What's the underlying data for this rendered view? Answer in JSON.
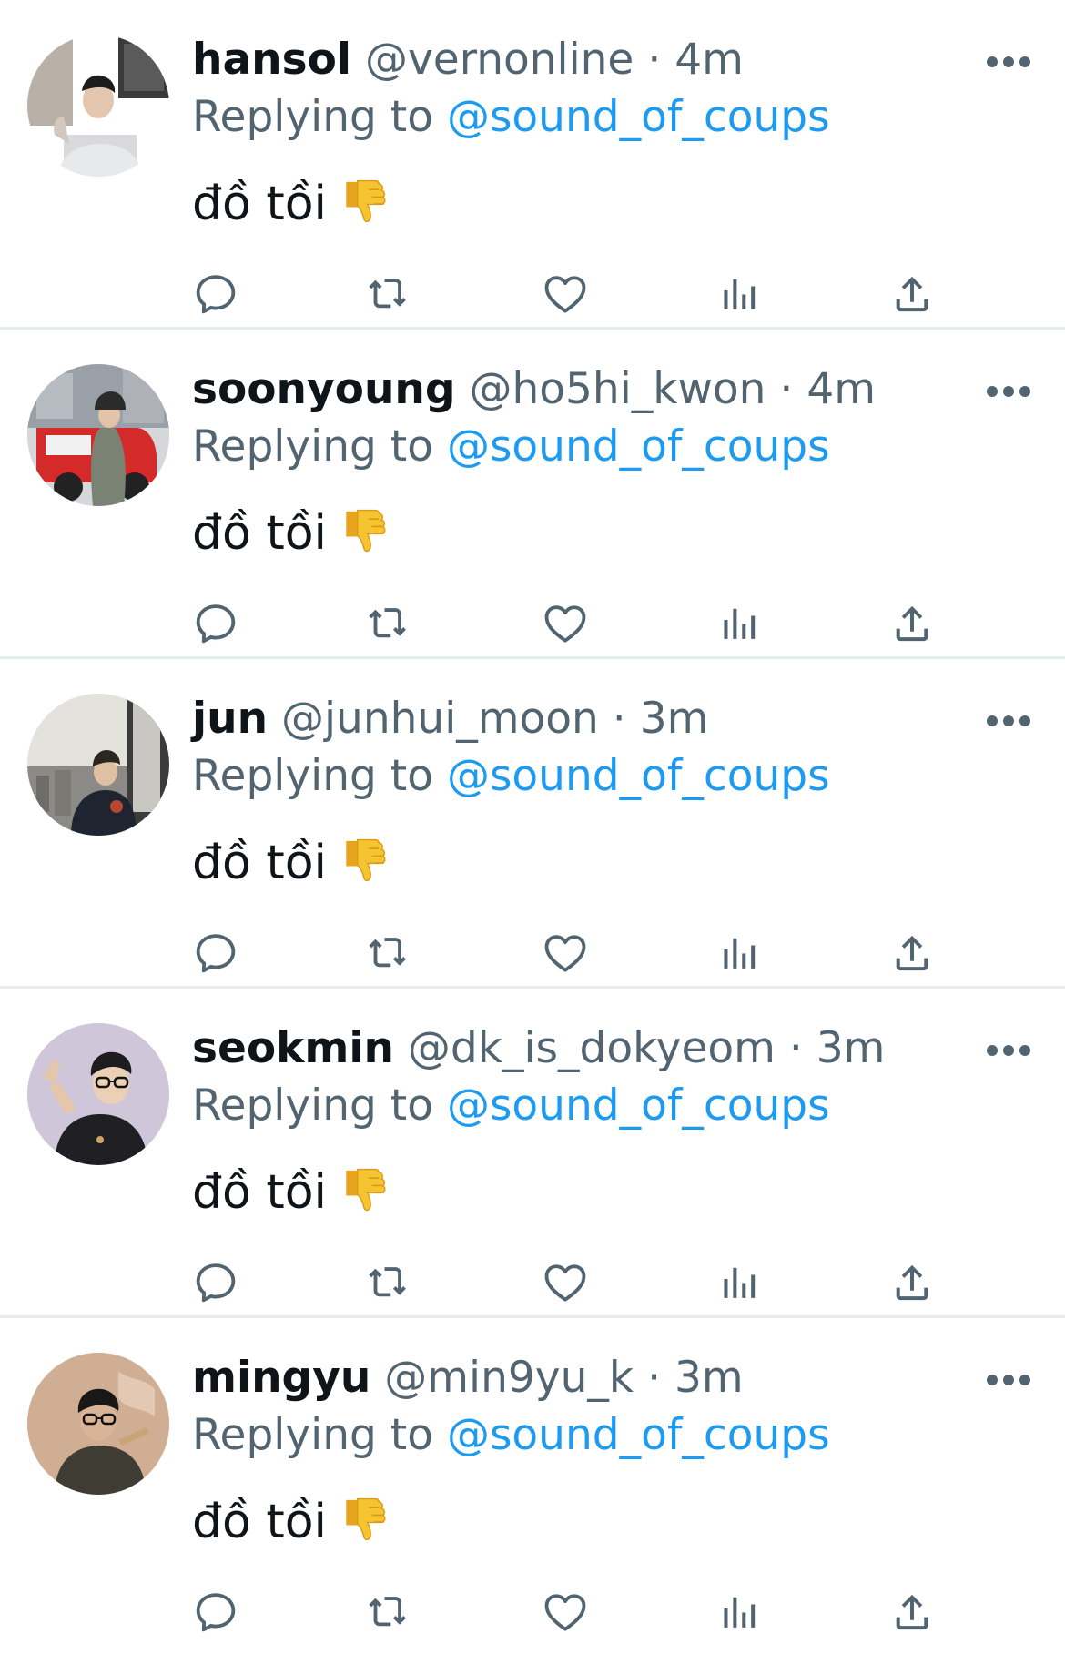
{
  "tweets": [
    {
      "display_name": "hansol",
      "handle": "@vernonline",
      "separator": "·",
      "time": "4m",
      "replying_prefix": "Replying to",
      "replying_to": "@sound_of_coups",
      "text": "đồ tồi",
      "emoji": "thumbs-down"
    },
    {
      "display_name": "soonyoung",
      "handle": "@ho5hi_kwon",
      "separator": "·",
      "time": "4m",
      "replying_prefix": "Replying to",
      "replying_to": "@sound_of_coups",
      "text": "đồ tồi",
      "emoji": "thumbs-down"
    },
    {
      "display_name": "jun",
      "handle": "@junhui_moon",
      "separator": "·",
      "time": "3m",
      "replying_prefix": "Replying to",
      "replying_to": "@sound_of_coups",
      "text": "đồ tồi",
      "emoji": "thumbs-down"
    },
    {
      "display_name": "seokmin",
      "handle": "@dk_is_dokyeom",
      "separator": "·",
      "time": "3m",
      "replying_prefix": "Replying to",
      "replying_to": "@sound_of_coups",
      "text": "đồ tồi",
      "emoji": "thumbs-down"
    },
    {
      "display_name": "mingyu",
      "handle": "@min9yu_k",
      "separator": "·",
      "time": "3m",
      "replying_prefix": "Replying to",
      "replying_to": "@sound_of_coups",
      "text": "đồ tồi",
      "emoji": "thumbs-down"
    }
  ],
  "actions": [
    "reply-icon",
    "retweet-icon",
    "like-icon",
    "views-icon",
    "share-icon"
  ],
  "colors": {
    "text_primary": "#0f1419",
    "text_secondary": "#536471",
    "link": "#1d9bf0",
    "divider": "#e6ecf0"
  }
}
